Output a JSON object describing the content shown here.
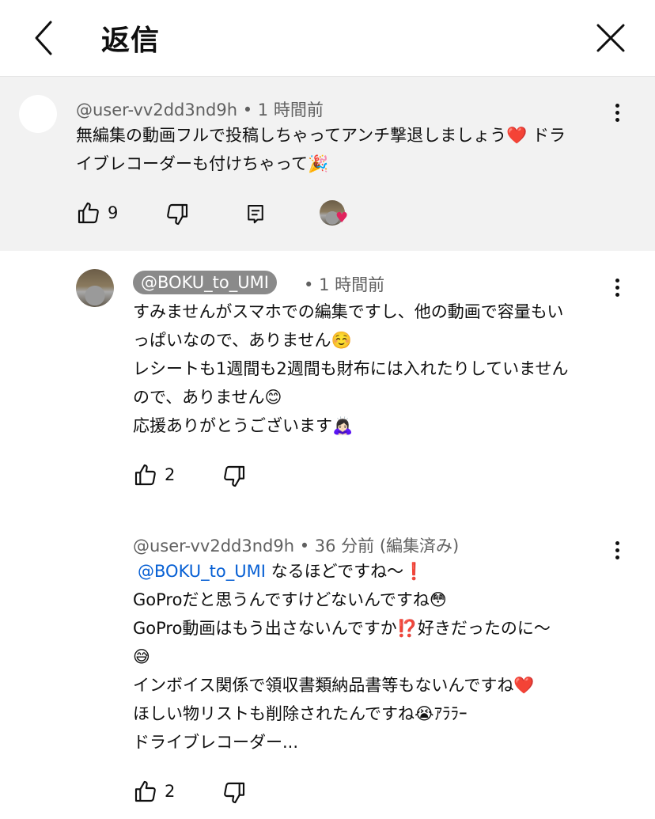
{
  "header": {
    "title": "返信"
  },
  "parent_comment": {
    "author": "@user-vv2dd3nd9h",
    "time": "1 時間前",
    "text_line1": "無編集の動画フルで投稿しちゃってアンチ撃退しましょう",
    "heart_emoji": "❤️",
    "text_line1_end": " ドラ",
    "text_line2": "イブレコーダーも付けちゃって",
    "party_emoji": "🎉",
    "likes": "9"
  },
  "reply_1": {
    "author": "@BOKU_to_UMI",
    "time": "1 時間前",
    "lines": [
      "すみませんがスマホでの編集ですし、他の動画で容量もい",
      "っぱいなので、ありません☺️",
      "レシートも1週間も2週間も財布には入れたりしていません",
      "ので、ありません😊",
      "応援ありがとうございます🙇🏻‍♀️"
    ],
    "likes": "2"
  },
  "reply_2": {
    "author": "@user-vv2dd3nd9h",
    "time": "36 分前 (編集済み)",
    "mention": "@BOKU_to_UMI",
    "line1_rest": " なるほどですね〜❗",
    "lines": [
      "GoProだと思うんですけどないんですね😳",
      "GoPro動画はもう出さないんですか⁉️好きだったのに〜",
      "😅",
      "インボイス関係で領収書類納品書等もないんですね❤️",
      "ほしい物リストも削除されたんですね😭ｱﾗﾗｰ",
      "ドライブレコーダー..."
    ],
    "likes": "2"
  },
  "icons": [
    "back-arrow-icon",
    "close-icon",
    "more-vert-icon",
    "like-icon",
    "dislike-icon",
    "reply-icon",
    "creator-heart-icon"
  ]
}
